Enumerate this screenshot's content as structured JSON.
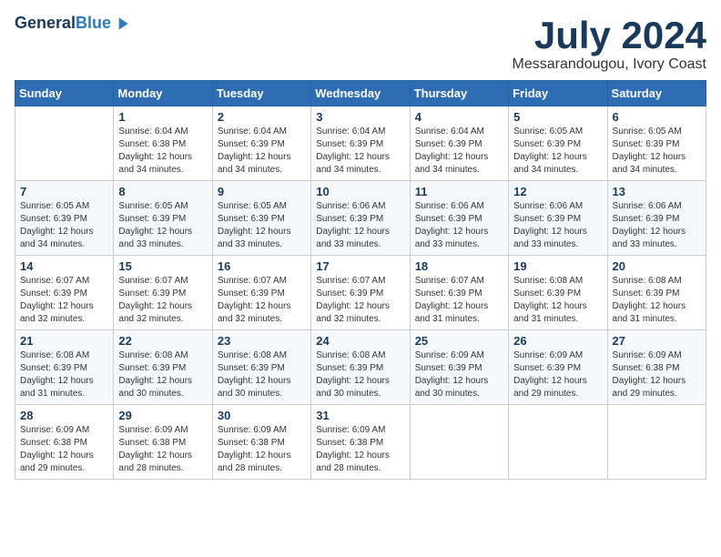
{
  "logo": {
    "line1": "General",
    "line2": "Blue"
  },
  "header": {
    "month": "July 2024",
    "location": "Messarandougou, Ivory Coast"
  },
  "weekdays": [
    "Sunday",
    "Monday",
    "Tuesday",
    "Wednesday",
    "Thursday",
    "Friday",
    "Saturday"
  ],
  "weeks": [
    [
      {
        "day": "",
        "sunrise": "",
        "sunset": "",
        "daylight": ""
      },
      {
        "day": "1",
        "sunrise": "Sunrise: 6:04 AM",
        "sunset": "Sunset: 6:38 PM",
        "daylight": "Daylight: 12 hours and 34 minutes."
      },
      {
        "day": "2",
        "sunrise": "Sunrise: 6:04 AM",
        "sunset": "Sunset: 6:39 PM",
        "daylight": "Daylight: 12 hours and 34 minutes."
      },
      {
        "day": "3",
        "sunrise": "Sunrise: 6:04 AM",
        "sunset": "Sunset: 6:39 PM",
        "daylight": "Daylight: 12 hours and 34 minutes."
      },
      {
        "day": "4",
        "sunrise": "Sunrise: 6:04 AM",
        "sunset": "Sunset: 6:39 PM",
        "daylight": "Daylight: 12 hours and 34 minutes."
      },
      {
        "day": "5",
        "sunrise": "Sunrise: 6:05 AM",
        "sunset": "Sunset: 6:39 PM",
        "daylight": "Daylight: 12 hours and 34 minutes."
      },
      {
        "day": "6",
        "sunrise": "Sunrise: 6:05 AM",
        "sunset": "Sunset: 6:39 PM",
        "daylight": "Daylight: 12 hours and 34 minutes."
      }
    ],
    [
      {
        "day": "7",
        "sunrise": "Sunrise: 6:05 AM",
        "sunset": "Sunset: 6:39 PM",
        "daylight": "Daylight: 12 hours and 34 minutes."
      },
      {
        "day": "8",
        "sunrise": "Sunrise: 6:05 AM",
        "sunset": "Sunset: 6:39 PM",
        "daylight": "Daylight: 12 hours and 33 minutes."
      },
      {
        "day": "9",
        "sunrise": "Sunrise: 6:05 AM",
        "sunset": "Sunset: 6:39 PM",
        "daylight": "Daylight: 12 hours and 33 minutes."
      },
      {
        "day": "10",
        "sunrise": "Sunrise: 6:06 AM",
        "sunset": "Sunset: 6:39 PM",
        "daylight": "Daylight: 12 hours and 33 minutes."
      },
      {
        "day": "11",
        "sunrise": "Sunrise: 6:06 AM",
        "sunset": "Sunset: 6:39 PM",
        "daylight": "Daylight: 12 hours and 33 minutes."
      },
      {
        "day": "12",
        "sunrise": "Sunrise: 6:06 AM",
        "sunset": "Sunset: 6:39 PM",
        "daylight": "Daylight: 12 hours and 33 minutes."
      },
      {
        "day": "13",
        "sunrise": "Sunrise: 6:06 AM",
        "sunset": "Sunset: 6:39 PM",
        "daylight": "Daylight: 12 hours and 33 minutes."
      }
    ],
    [
      {
        "day": "14",
        "sunrise": "Sunrise: 6:07 AM",
        "sunset": "Sunset: 6:39 PM",
        "daylight": "Daylight: 12 hours and 32 minutes."
      },
      {
        "day": "15",
        "sunrise": "Sunrise: 6:07 AM",
        "sunset": "Sunset: 6:39 PM",
        "daylight": "Daylight: 12 hours and 32 minutes."
      },
      {
        "day": "16",
        "sunrise": "Sunrise: 6:07 AM",
        "sunset": "Sunset: 6:39 PM",
        "daylight": "Daylight: 12 hours and 32 minutes."
      },
      {
        "day": "17",
        "sunrise": "Sunrise: 6:07 AM",
        "sunset": "Sunset: 6:39 PM",
        "daylight": "Daylight: 12 hours and 32 minutes."
      },
      {
        "day": "18",
        "sunrise": "Sunrise: 6:07 AM",
        "sunset": "Sunset: 6:39 PM",
        "daylight": "Daylight: 12 hours and 31 minutes."
      },
      {
        "day": "19",
        "sunrise": "Sunrise: 6:08 AM",
        "sunset": "Sunset: 6:39 PM",
        "daylight": "Daylight: 12 hours and 31 minutes."
      },
      {
        "day": "20",
        "sunrise": "Sunrise: 6:08 AM",
        "sunset": "Sunset: 6:39 PM",
        "daylight": "Daylight: 12 hours and 31 minutes."
      }
    ],
    [
      {
        "day": "21",
        "sunrise": "Sunrise: 6:08 AM",
        "sunset": "Sunset: 6:39 PM",
        "daylight": "Daylight: 12 hours and 31 minutes."
      },
      {
        "day": "22",
        "sunrise": "Sunrise: 6:08 AM",
        "sunset": "Sunset: 6:39 PM",
        "daylight": "Daylight: 12 hours and 30 minutes."
      },
      {
        "day": "23",
        "sunrise": "Sunrise: 6:08 AM",
        "sunset": "Sunset: 6:39 PM",
        "daylight": "Daylight: 12 hours and 30 minutes."
      },
      {
        "day": "24",
        "sunrise": "Sunrise: 6:08 AM",
        "sunset": "Sunset: 6:39 PM",
        "daylight": "Daylight: 12 hours and 30 minutes."
      },
      {
        "day": "25",
        "sunrise": "Sunrise: 6:09 AM",
        "sunset": "Sunset: 6:39 PM",
        "daylight": "Daylight: 12 hours and 30 minutes."
      },
      {
        "day": "26",
        "sunrise": "Sunrise: 6:09 AM",
        "sunset": "Sunset: 6:39 PM",
        "daylight": "Daylight: 12 hours and 29 minutes."
      },
      {
        "day": "27",
        "sunrise": "Sunrise: 6:09 AM",
        "sunset": "Sunset: 6:38 PM",
        "daylight": "Daylight: 12 hours and 29 minutes."
      }
    ],
    [
      {
        "day": "28",
        "sunrise": "Sunrise: 6:09 AM",
        "sunset": "Sunset: 6:38 PM",
        "daylight": "Daylight: 12 hours and 29 minutes."
      },
      {
        "day": "29",
        "sunrise": "Sunrise: 6:09 AM",
        "sunset": "Sunset: 6:38 PM",
        "daylight": "Daylight: 12 hours and 28 minutes."
      },
      {
        "day": "30",
        "sunrise": "Sunrise: 6:09 AM",
        "sunset": "Sunset: 6:38 PM",
        "daylight": "Daylight: 12 hours and 28 minutes."
      },
      {
        "day": "31",
        "sunrise": "Sunrise: 6:09 AM",
        "sunset": "Sunset: 6:38 PM",
        "daylight": "Daylight: 12 hours and 28 minutes."
      },
      {
        "day": "",
        "sunrise": "",
        "sunset": "",
        "daylight": ""
      },
      {
        "day": "",
        "sunrise": "",
        "sunset": "",
        "daylight": ""
      },
      {
        "day": "",
        "sunrise": "",
        "sunset": "",
        "daylight": ""
      }
    ]
  ]
}
